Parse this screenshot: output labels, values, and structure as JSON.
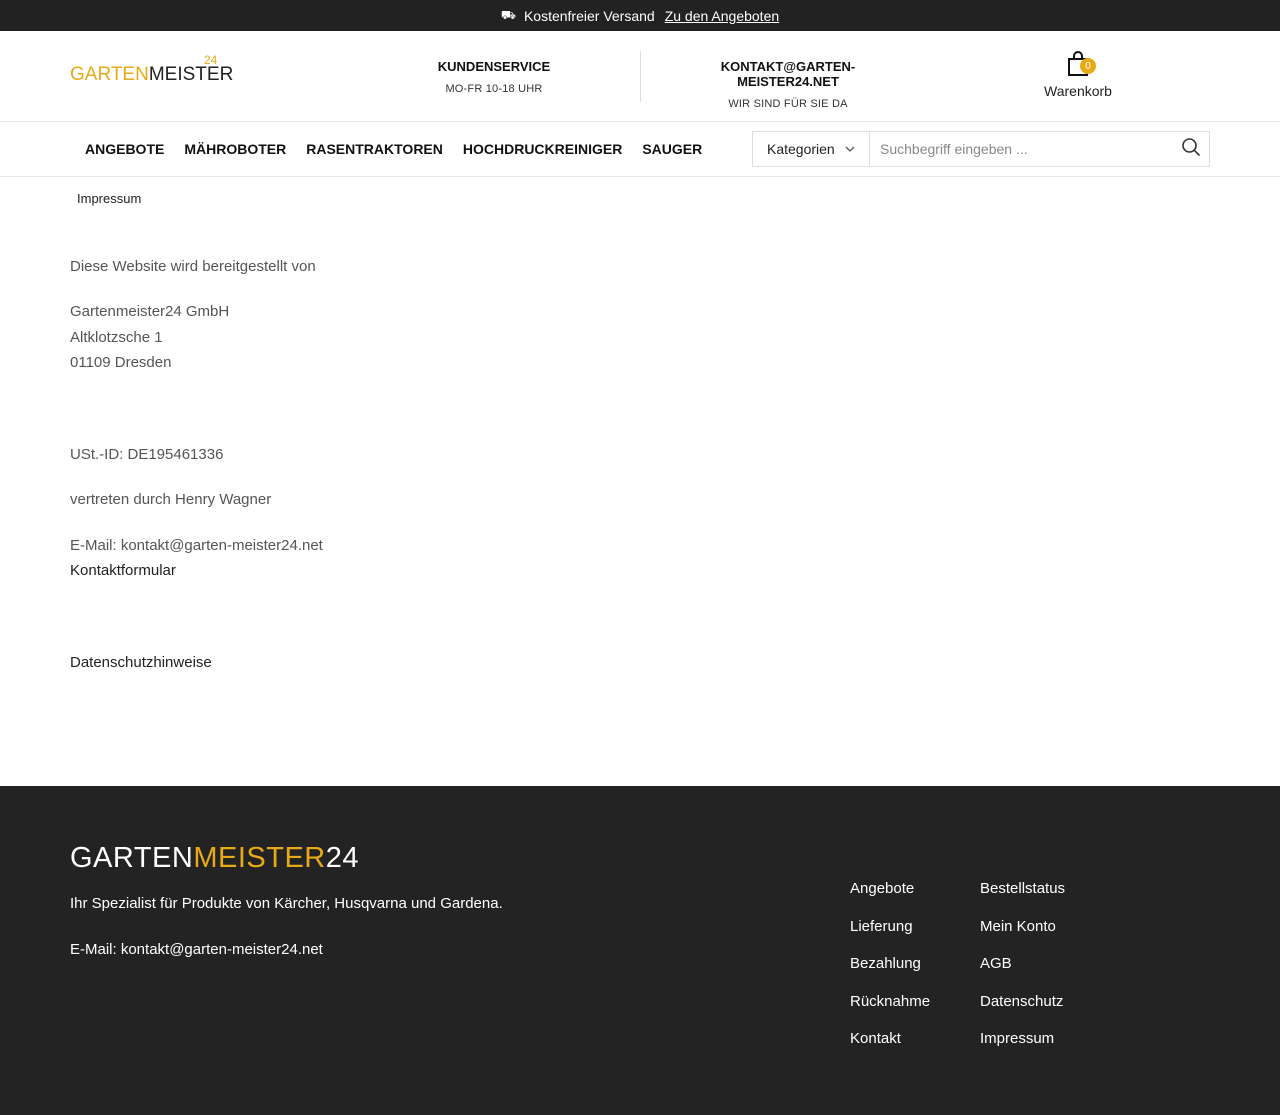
{
  "topbar": {
    "shipping_text": "Kostenfreier Versand",
    "offers_link": "Zu den Angeboten"
  },
  "header": {
    "logo": {
      "part1": "GARTEN",
      "part2": "MEISTER",
      "part3": "24"
    },
    "service": {
      "title": "KUNDENSERVICE",
      "subtitle": "MO-FR 10-18 UHR"
    },
    "contact": {
      "title": "KONTAKT@GARTEN-MEISTER24.NET",
      "subtitle": "WIR SIND FÜR SIE DA"
    },
    "cart": {
      "label": "Warenkorb",
      "count": "0"
    }
  },
  "nav": {
    "items": [
      {
        "label": "ANGEBOTE"
      },
      {
        "label": "MÄHROBOTER"
      },
      {
        "label": "RASENTRAKTOREN"
      },
      {
        "label": "HOCHDRUCKREINIGER"
      },
      {
        "label": "SAUGER"
      }
    ]
  },
  "search": {
    "category_label": "Kategorien",
    "placeholder": "Suchbegriff eingeben ..."
  },
  "breadcrumb": "Impressum",
  "content": {
    "intro": "Diese Website wird bereitgestellt von",
    "company": "Gartenmeister24 GmbH",
    "street": "Altklotzsche 1",
    "city": "01109 Dresden",
    "vat": "USt.-ID: DE195461336",
    "represented": "vertreten durch Henry Wagner",
    "email": "E-Mail: kontakt@garten-meister24.net",
    "contact_form": "Kontaktformular",
    "privacy_link": "Datenschutzhinweise"
  },
  "footer": {
    "logo": {
      "part1": "GARTEN",
      "part2": "MEISTER",
      "part3": "24"
    },
    "tagline": "Ihr Spezialist für Produkte von Kärcher, Husqvarna und Gardena.",
    "email": "E-Mail: kontakt@garten-meister24.net",
    "col1": [
      "Angebote",
      "Lieferung",
      "Bezahlung",
      "Rücknahme",
      "Kontakt"
    ],
    "col2": [
      "Bestellstatus",
      "Mein Konto",
      "AGB",
      "Datenschutz",
      "Impressum"
    ]
  },
  "colors": {
    "accent": "#e8a916",
    "dark": "#222222"
  },
  "icons": {
    "shipping": "truck-icon",
    "cart": "shopping-bag-icon",
    "search": "search-icon",
    "dropdown": "chevron-down-icon"
  }
}
